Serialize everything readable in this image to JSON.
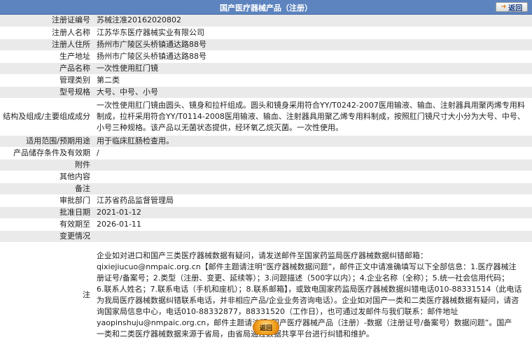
{
  "header": {
    "title": "国产医疗器械产品（注册）",
    "back_label": "返回"
  },
  "rows": [
    {
      "label": "注册证编号",
      "value": "苏械注准20162020802"
    },
    {
      "label": "注册人名称",
      "value": "江苏华东医疗器械实业有限公司"
    },
    {
      "label": "注册人住所",
      "value": "扬州市广陵区头桥镇通达路88号"
    },
    {
      "label": "生产地址",
      "value": "扬州市广陵区头桥镇通达路88号"
    },
    {
      "label": "产品名称",
      "value": "一次性使用肛门镜"
    },
    {
      "label": "管理类别",
      "value": "第二类"
    },
    {
      "label": "型号规格",
      "value": "大号、中号、小号"
    },
    {
      "label": "结构及组成/主要组成成分",
      "value_lines": [
        "一次性使用肛门镜由圆头、镜身和拉杆组成。圆头和镜身采用符合YY/T0242-2007医用输液、输血、注射器具用聚丙烯专用料",
        "制成，拉杆采用符合YY/T0114-2008医用输液、输血、注射器具用聚乙烯专用料制成，按照肛门镜尺寸大小分为大号、中号、",
        "小号三种规格。该产品以无菌状态提供，经环氧乙烷灭菌。一次性使用。"
      ]
    },
    {
      "label": "适用范围/预期用途",
      "value": "用于临床肛肠检查用。"
    },
    {
      "label": "产品储存条件及有效期",
      "value": "/"
    },
    {
      "label": "附件",
      "value": ""
    },
    {
      "label": "其他内容",
      "value": ""
    },
    {
      "label": "备注",
      "value": ""
    },
    {
      "label": "审批部门",
      "value": "江苏省药品监督管理局"
    },
    {
      "label": "批准日期",
      "value": "2021-01-12"
    },
    {
      "label": "有效期至",
      "value": "2026-01-11"
    },
    {
      "label": "变更情况",
      "value": ""
    }
  ],
  "note": {
    "label": "注",
    "lines": [
      "企业如对进口和国产三类医疗器械数据有疑问，请发送邮件至国家药监局医疗器械数据纠错邮箱：",
      "qixiejiucuo@nmpaic.org.cn【邮件主题请注明“医疗器械数据问题”，邮件正文中请准确填写以下全部信息：1.医疗器械注",
      "册证号/备案号；2.类型（注册、变更、延续等）；3.问题描述（500字以内）；4.企业名称（全称）；5.统一社会信用代码；",
      "6.联系人姓名；7.联系电话（手机和座机）；8.联系邮箱】，或致电国家药监局医疗器械数据纠错电话010-88331514（此电话",
      "为我局医疗器械数据纠错联系电话，并非相应产品/企业业务咨询电话）。企业如对国产一类和二类医疗器械数据有疑问，请咨",
      "询国家局信息中心，电话010-88332877，88331520（工作日），也可通过发邮件与我们联系：邮件地址",
      "yaopinshuju@nmpaic.org.cn，邮件主题请注明“国产医疗器械产品（注册）-数据（注册证号/备案号）数据问题”。国产",
      "一类和二类医疗器械数据来源于省局，由省局通过数据共享平台进行纠错和维护。"
    ]
  },
  "footer": {
    "back_label": "返回"
  },
  "colors": {
    "header_bg": "#5d84bf",
    "row_alt_bg": "#eaeaea",
    "button_orange": "#f2a21e"
  }
}
